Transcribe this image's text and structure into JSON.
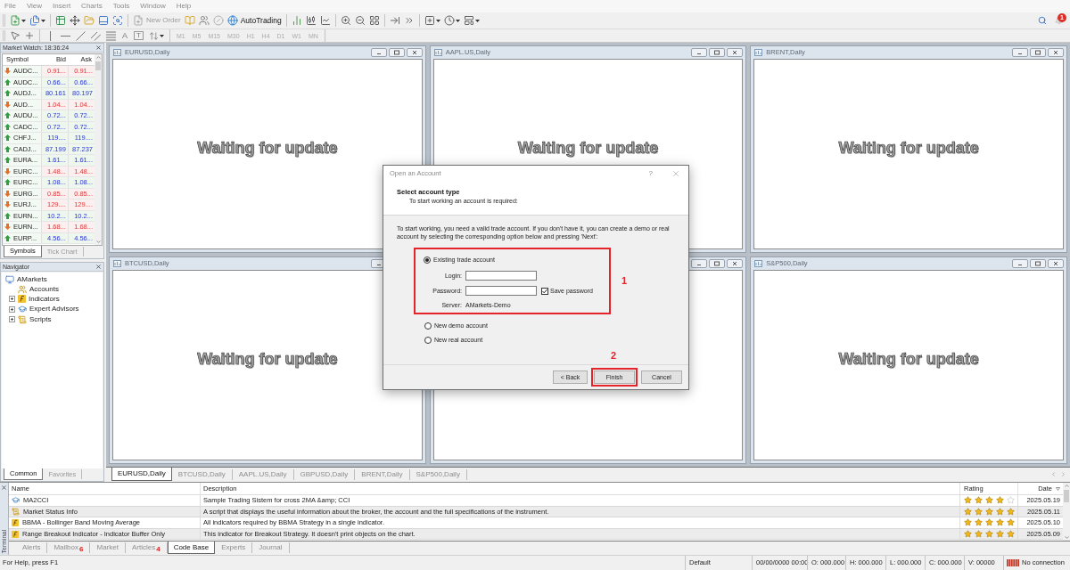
{
  "menu_bar": {
    "items": [
      "File",
      "View",
      "Insert",
      "Charts",
      "Tools",
      "Window",
      "Help"
    ]
  },
  "toolbar": {
    "new_order": {
      "label": "New Order",
      "disabled": true
    },
    "auto_trading": {
      "label": "AutoTrading"
    },
    "notifications": {
      "count": "1"
    },
    "text_tools": [
      "A",
      "T"
    ],
    "periods": [
      {
        "label": "M1",
        "disabled": true
      },
      {
        "label": "M5",
        "disabled": true
      },
      {
        "label": "M15",
        "disabled": true
      },
      {
        "label": "M30",
        "disabled": true
      },
      {
        "label": "H1",
        "disabled": true
      },
      {
        "label": "H4",
        "disabled": true
      },
      {
        "label": "D1",
        "disabled": true
      },
      {
        "label": "W1",
        "disabled": true
      },
      {
        "label": "MN",
        "disabled": true
      }
    ]
  },
  "market_watch": {
    "title": "Market Watch: 18:36:24",
    "columns": [
      "Symbol",
      "Bid",
      "Ask"
    ],
    "rows": [
      {
        "symbol": "AUDC...",
        "bid": "0.91...",
        "ask": "0.91...",
        "rising": false
      },
      {
        "symbol": "AUDC...",
        "bid": "0.66...",
        "ask": "0.66...",
        "rising": true
      },
      {
        "symbol": "AUDJ...",
        "bid": "80.161",
        "ask": "80.197",
        "rising": true
      },
      {
        "symbol": "AUD...",
        "bid": "1.04...",
        "ask": "1.04...",
        "rising": false
      },
      {
        "symbol": "AUDU...",
        "bid": "0.72...",
        "ask": "0.72...",
        "rising": true
      },
      {
        "symbol": "CADC...",
        "bid": "0.72...",
        "ask": "0.72...",
        "rising": true
      },
      {
        "symbol": "CHFJ...",
        "bid": "119....",
        "ask": "119....",
        "rising": true
      },
      {
        "symbol": "CADJ...",
        "bid": "87.199",
        "ask": "87.237",
        "rising": true
      },
      {
        "symbol": "EURA...",
        "bid": "1.61...",
        "ask": "1.61...",
        "rising": true
      },
      {
        "symbol": "EURC...",
        "bid": "1.48...",
        "ask": "1.48...",
        "rising": false
      },
      {
        "symbol": "EURC...",
        "bid": "1.08...",
        "ask": "1.08...",
        "rising": true
      },
      {
        "symbol": "EURG...",
        "bid": "0.85...",
        "ask": "0.85...",
        "rising": false
      },
      {
        "symbol": "EURJ...",
        "bid": "129....",
        "ask": "129....",
        "rising": false
      },
      {
        "symbol": "EURN...",
        "bid": "10.2...",
        "ask": "10.2...",
        "rising": true
      },
      {
        "symbol": "EURN...",
        "bid": "1.68...",
        "ask": "1.68...",
        "rising": false
      },
      {
        "symbol": "EURP...",
        "bid": "4.56...",
        "ask": "4.56...",
        "rising": true
      }
    ],
    "tabs": [
      {
        "label": "Symbols",
        "selected": true
      },
      {
        "label": "Tick Chart",
        "selected": false
      }
    ]
  },
  "navigator": {
    "title": "Navigator",
    "tree": [
      {
        "label": "AMarkets",
        "kind": "broker",
        "children": [
          {
            "label": "Accounts",
            "kind": "accounts",
            "expandable": false
          },
          {
            "label": "Indicators",
            "kind": "indicators",
            "expandable": true
          },
          {
            "label": "Expert Advisors",
            "kind": "experts",
            "expandable": true
          },
          {
            "label": "Scripts",
            "kind": "scripts",
            "expandable": true
          }
        ]
      }
    ],
    "tabs": [
      {
        "label": "Common",
        "selected": true
      },
      {
        "label": "Favorites",
        "selected": false
      }
    ]
  },
  "chart_windows": [
    {
      "kind": "chart",
      "title": "EURUSD,Daily",
      "message": "Waiting for update"
    },
    {
      "kind": "chart",
      "title": "AAPL.US,Daily",
      "message": "Waiting for update"
    },
    {
      "kind": "chart",
      "title": "BRENT,Daily",
      "message": "Waiting for update"
    },
    {
      "kind": "chart",
      "title": "BTCUSD,Daily",
      "message": "Waiting for update"
    },
    {
      "kind": "chart"
    },
    {
      "kind": "chart",
      "title": "S&P500,Daily",
      "message": "Waiting for update"
    }
  ],
  "chart_tabs": [
    {
      "label": "EURUSD,Daily",
      "selected": true
    },
    {
      "label": "BTCUSD,Daily",
      "selected": false
    },
    {
      "label": "AAPL.US,Daily",
      "selected": false
    },
    {
      "label": "GBPUSD,Daily",
      "selected": false
    },
    {
      "label": "BRENT,Daily",
      "selected": false
    },
    {
      "label": "S&P500,Daily",
      "selected": false
    }
  ],
  "dialog": {
    "title": "Open an Account",
    "help": "?",
    "heading": "Select account type",
    "subheading": "To start working an account is required:",
    "intro": "To start working, you need a valid trade account. If you don't have it, you can create a demo or real account by selecting the corresponding option below and pressing 'Next':",
    "options": [
      {
        "label": "Existing trade account",
        "selected": true
      },
      {
        "label": "New demo account",
        "selected": false
      },
      {
        "label": "New real account",
        "selected": false
      }
    ],
    "login_label": "Login:",
    "password_label": "Password:",
    "save_password": {
      "label": "Save password",
      "checked": true
    },
    "server_label": "Server:",
    "server": "AMarkets-Demo",
    "buttons": [
      {
        "label": "< Back"
      },
      {
        "label": "Finish"
      },
      {
        "label": "Cancel"
      }
    ],
    "annotations": [
      "1",
      "2"
    ]
  },
  "terminal": {
    "title": "Terminal",
    "columns": [
      "Name",
      "Description",
      "Rating",
      "Date"
    ],
    "rows": [
      {
        "kind": "expert",
        "name": "MA2CCI",
        "description": "Sample Trading Sistem for cross 2MA &amp; CCI",
        "stars": 4,
        "date": "2025.05.19"
      },
      {
        "kind": "script",
        "name": "Market Status Info",
        "description": "A script that displays the useful information about the broker, the account and the full specifications of the instrument.",
        "stars": 5,
        "date": "2025.05.11"
      },
      {
        "kind": "indicator",
        "name": "BBMA - Bollinger Band Moving Average",
        "description": "All indicators required by BBMA Strategy in a single indicator.",
        "stars": 5,
        "date": "2025.05.10"
      },
      {
        "kind": "indicator",
        "name": "Range Breakout Indicator - Indicator Buffer Only",
        "description": "This indicator for Breakout Strategy. It doesn't print objects on the chart.",
        "stars": 5,
        "date": "2025.05.09"
      }
    ],
    "tabs": [
      {
        "label": "Alerts",
        "selected": false
      },
      {
        "label": "Mailbox",
        "count": "6",
        "selected": false
      },
      {
        "label": "Market",
        "selected": false
      },
      {
        "label": "Articles",
        "count": "4",
        "selected": false
      },
      {
        "label": "Code Base",
        "selected": true
      },
      {
        "label": "Experts",
        "selected": false
      },
      {
        "label": "Journal",
        "selected": false
      }
    ]
  },
  "status_bar": {
    "help": "For Help, press F1",
    "cells": [
      "Default",
      "00/00/0000 00:00",
      "O: 000.000",
      "H: 000.000",
      "L: 000.000",
      "C: 000.000",
      "V: 00000"
    ],
    "connection": "No connection"
  }
}
